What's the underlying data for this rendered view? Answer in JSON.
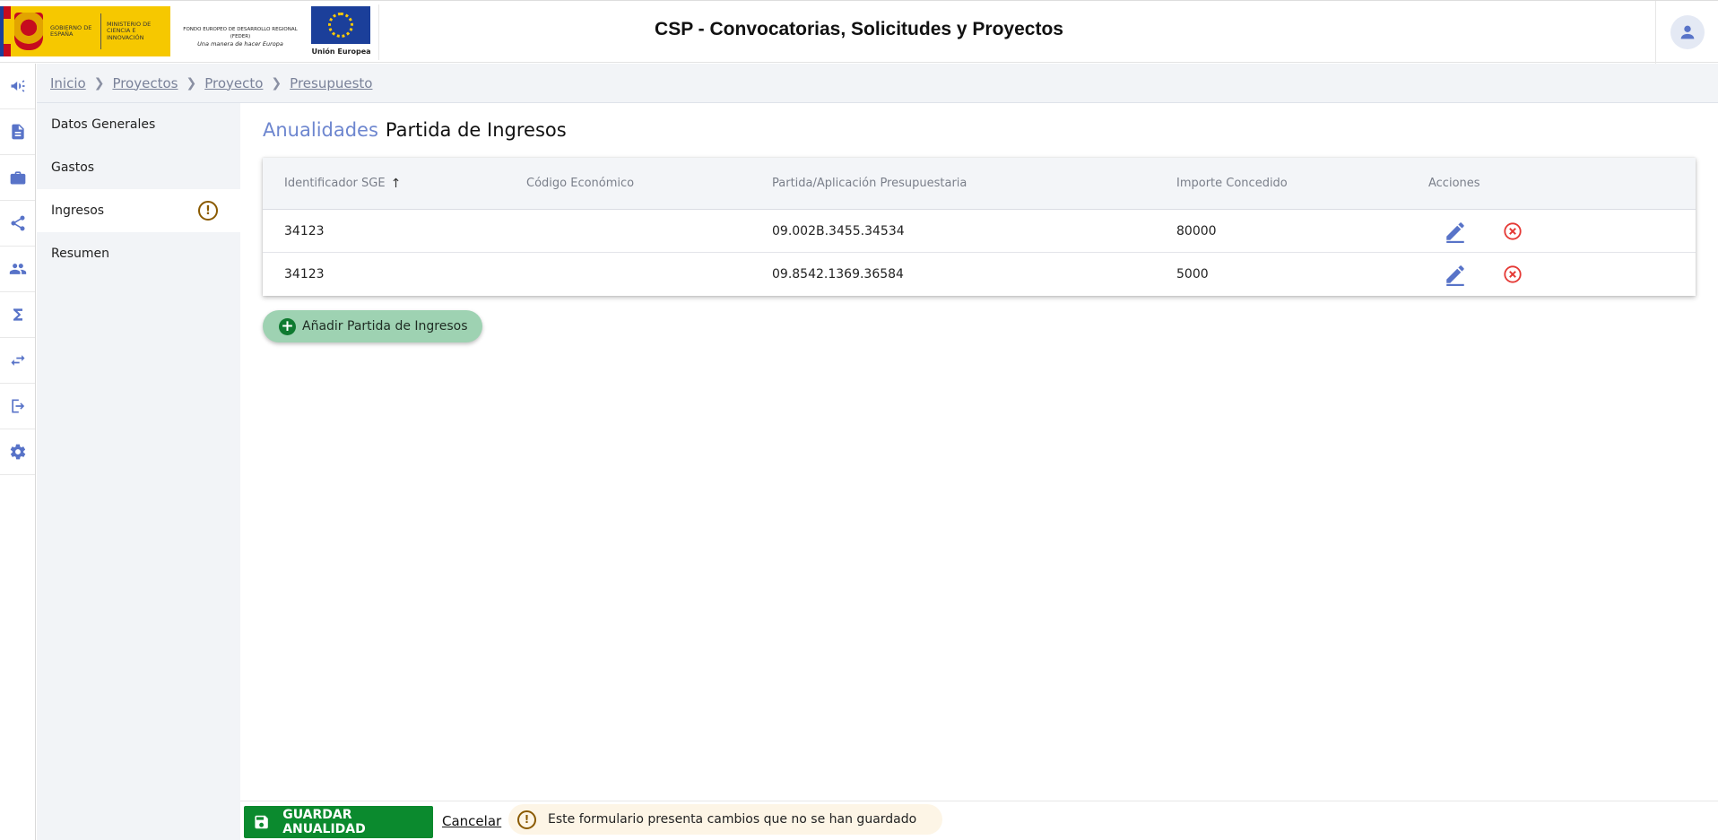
{
  "header": {
    "title": "CSP - Convocatorias, Solicitudes y Proyectos",
    "logo_gobierno": "GOBIERNO DE ESPAÑA",
    "logo_ministerio": "MINISTERIO DE CIENCIA E INNOVACIÓN",
    "feder_text": "FONDO EUROPEO DE DESARROLLO REGIONAL (FEDER)",
    "feder_motto": "Una manera de hacer Europa",
    "eu_label": "Unión Europea"
  },
  "rail": [
    "megaphone-icon",
    "document-icon",
    "briefcase-icon",
    "share-icon",
    "people-icon",
    "sigma-icon",
    "transfer-icon",
    "logout-icon",
    "gear-icon"
  ],
  "breadcrumb": [
    "Inicio",
    "Proyectos",
    "Proyecto",
    "Presupuesto"
  ],
  "sidenav": {
    "items": [
      "Datos Generales",
      "Gastos",
      "Ingresos",
      "Resumen"
    ],
    "active": "Ingresos",
    "warning_symbol": "!"
  },
  "main": {
    "title_primary": "Anualidades",
    "title_secondary": "Partida de Ingresos",
    "table": {
      "headers": [
        "Identificador SGE",
        "Código Económico",
        "Partida/Aplicación Presupuestaria",
        "Importe Concedido",
        "Acciones"
      ],
      "sort_symbol": "↑",
      "rows": [
        [
          "34123",
          "",
          "09.002B.3455.34534",
          "80000"
        ],
        [
          "34123",
          "",
          "09.8542.1369.36584",
          "5000"
        ]
      ]
    },
    "add_button": "Añadir Partida de Ingresos",
    "add_symbol": "+"
  },
  "footer": {
    "save_label": "GUARDAR ANUALIDAD",
    "cancel_label": "Cancelar",
    "warning_text": "Este formulario presenta cambios que no se han guardado",
    "warning_symbol": "!"
  },
  "colors": {
    "accent": "#5873c8",
    "title_accent": "#6d86cf",
    "save_green": "#0b8a2e",
    "add_green": "#9ed2b2",
    "delete_red": "#e53935",
    "warning": "#8a5a00"
  }
}
